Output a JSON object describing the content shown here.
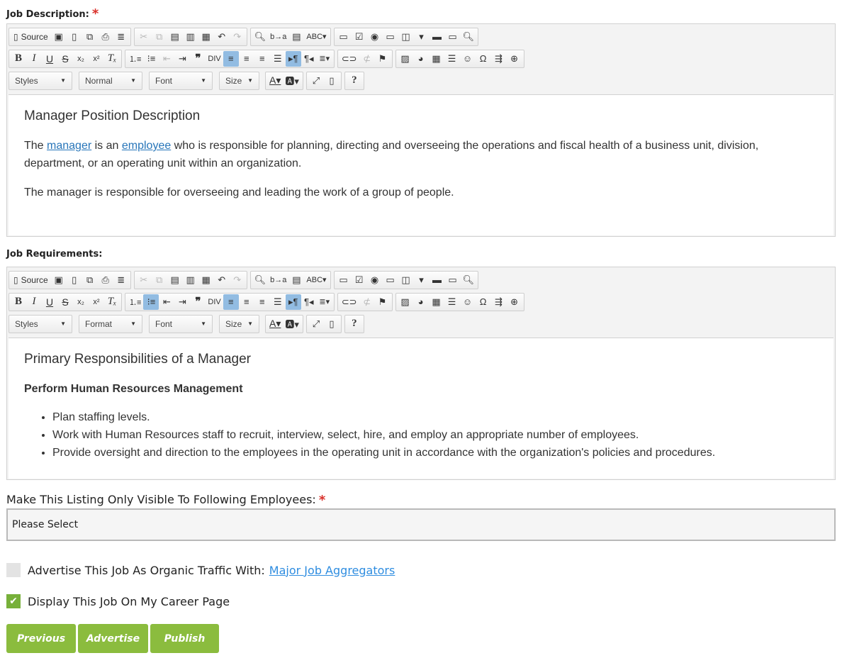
{
  "job_description": {
    "label": "Job Description:",
    "required_mark": "*",
    "toolbar": {
      "source_label": "Source",
      "styles_label": "Styles",
      "format_label": "Normal",
      "font_label": "Font",
      "size_label": "Size",
      "help_label": "?"
    },
    "heading": "Manager Position Description",
    "para1_pre": "The ",
    "link_manager": "manager",
    "para1_mid": " is an ",
    "link_employee": "employee",
    "para1_post": " who is responsible for planning, directing and overseeing the operations and fiscal health of a business unit, division, department, or an operating unit within an organization.",
    "para2": "The manager is responsible for overseeing and leading the work of a group of people."
  },
  "job_requirements": {
    "label": "Job Requirements:",
    "toolbar": {
      "source_label": "Source",
      "styles_label": "Styles",
      "format_label": "Format",
      "font_label": "Font",
      "size_label": "Size",
      "help_label": "?"
    },
    "heading": "Primary Responsibilities of a Manager",
    "subheading": "Perform Human Resources Management",
    "bullets": [
      "Plan staffing levels.",
      "Work with Human Resources staff to recruit, interview, select, hire, and employ an appropriate number of employees.",
      "Provide oversight and direction to the employees in the operating unit in accordance with the organization's policies and procedures."
    ]
  },
  "visibility": {
    "label": "Make This Listing Only Visible To Following Employees:",
    "required_mark": "*",
    "select_value": "Please Select"
  },
  "advertise_organic": {
    "label": "Advertise This Job As Organic Traffic With:",
    "link": "Major Job Aggregators",
    "checked": false
  },
  "career_page": {
    "label": "Display This Job On My Career Page",
    "checked": true
  },
  "buttons": {
    "previous": "Previous",
    "advertise": "Advertise",
    "publish": "Publish"
  },
  "colors": {
    "accent_green": "#8bbc3e",
    "link_blue": "#2775b9",
    "required_red": "#d9302a",
    "toolbar_active": "#92bce2"
  }
}
